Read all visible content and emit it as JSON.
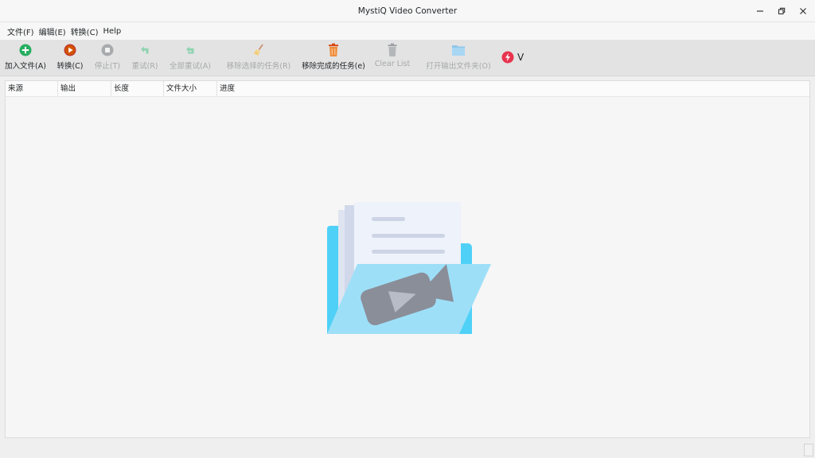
{
  "window": {
    "title": "MystiQ Video Converter",
    "controls": [
      "minimize",
      "restore",
      "close"
    ]
  },
  "menubar": {
    "items": [
      {
        "label": "文件(F)"
      },
      {
        "label": "编辑(E)"
      },
      {
        "label": "转换(C)"
      },
      {
        "label": "Help"
      }
    ]
  },
  "toolbar": {
    "add_files": {
      "label": "加入文件(A)",
      "icon": "plus-circle-icon",
      "color": "#27ae60",
      "enabled": true
    },
    "convert": {
      "label": "转换(C)",
      "icon": "play-circle-icon",
      "color": "#d35400",
      "enabled": true
    },
    "stop": {
      "label": "停止(T)",
      "icon": "stop-circle-icon",
      "enabled": false
    },
    "retry": {
      "label": "重试(R)",
      "icon": "retry-icon",
      "enabled": false
    },
    "retry_all": {
      "label": "全部重试(A)",
      "icon": "retry-all-icon",
      "enabled": false
    },
    "remove_selected": {
      "label": "移除选择的任务(R)",
      "icon": "broom-icon",
      "enabled": false
    },
    "remove_completed": {
      "label": "移除完成的任务(e)",
      "icon": "trash-icon",
      "color": "#e8590c",
      "enabled": true
    },
    "clear_list": {
      "label": "Clear List",
      "icon": "trash-gray-icon",
      "enabled": false
    },
    "open_output": {
      "label": "打开输出文件夹(O)",
      "icon": "folder-icon",
      "enabled": false
    },
    "power": {
      "icon": "lightning-icon",
      "color": "#e8344e"
    },
    "more": {
      "label": "V"
    }
  },
  "table": {
    "columns": [
      {
        "label": "来源"
      },
      {
        "label": "输出"
      },
      {
        "label": "长度"
      },
      {
        "label": "文件大小"
      },
      {
        "label": "进度"
      }
    ],
    "rows": [],
    "empty_illustration": "folder-with-video-icon"
  }
}
